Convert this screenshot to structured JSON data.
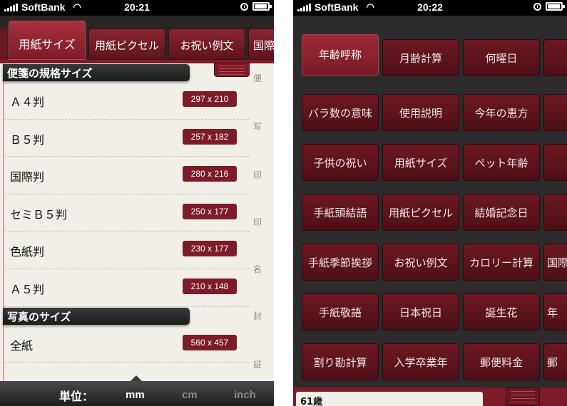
{
  "left_status": {
    "carrier": "SoftBank",
    "time": "20:21"
  },
  "right_status": {
    "carrier": "SoftBank",
    "time": "20:22"
  },
  "tabs": [
    {
      "label": "用紙サイズ",
      "active": true
    },
    {
      "label": "用紙ピクセル",
      "active": false
    },
    {
      "label": "お祝い例文",
      "active": false
    },
    {
      "label": "国際",
      "active": false
    }
  ],
  "sections": [
    {
      "title": "便箋の規格サイズ",
      "rows": [
        {
          "label": "Ａ４判",
          "size": "297 x 210"
        },
        {
          "label": "Ｂ５判",
          "size": "257 x 182"
        },
        {
          "label": "国際判",
          "size": "280 x 216"
        },
        {
          "label": "セミＢ５判",
          "size": "250 x 177"
        },
        {
          "label": "色紙判",
          "size": "230 x 177"
        },
        {
          "label": "Ａ５判",
          "size": "210 x 148"
        }
      ]
    },
    {
      "title": "写真のサイズ",
      "rows": [
        {
          "label": "全紙",
          "size": "560 x 457"
        }
      ]
    }
  ],
  "index_chars": [
    "便",
    "写",
    "印",
    "印",
    "名",
    "封",
    "証"
  ],
  "unit_bar": {
    "label": "単位：",
    "options": [
      {
        "label": "mm",
        "selected": true
      },
      {
        "label": "cm",
        "selected": false
      },
      {
        "label": "inch",
        "selected": false
      }
    ]
  },
  "menu_grid": [
    [
      "年齢呼称",
      "月齢計算",
      "何曜日",
      ""
    ],
    [
      "バラ数の意味",
      "使用説明",
      "今年の恵方",
      ""
    ],
    [
      "子供の祝い",
      "用紙サイズ",
      "ペット年齢",
      ""
    ],
    [
      "手紙頭結語",
      "用紙ピクセル",
      "結婚記念日",
      ""
    ],
    [
      "手紙季節挨拶",
      "お祝い例文",
      "カロリー計算",
      "国際"
    ],
    [
      "手紙敬語",
      "日本祝日",
      "誕生花",
      "年"
    ],
    [
      "割り勘計算",
      "入学卒業年",
      "郵便料金",
      "郵"
    ]
  ],
  "menu_active": "年齢呼称",
  "bottom_field": "61歳"
}
